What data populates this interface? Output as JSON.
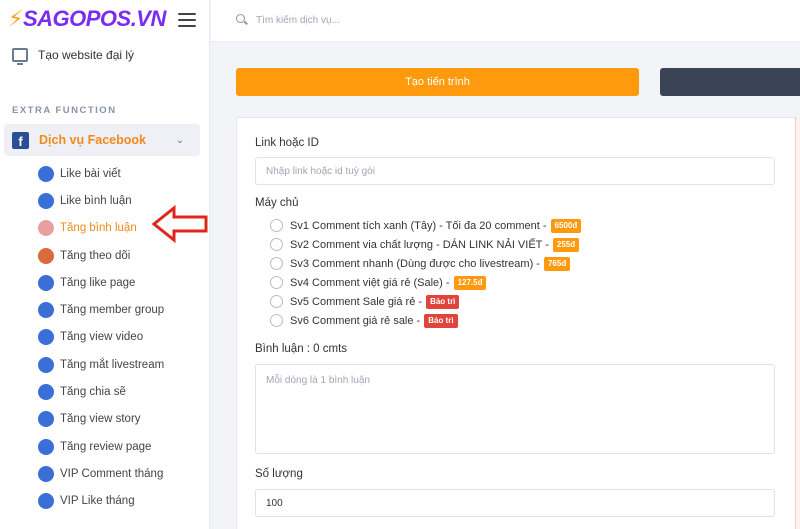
{
  "brand": {
    "logo_text": "SAGOPOS.VN"
  },
  "sidebar": {
    "agency_label": "Tạo website đại lý",
    "section_title": "EXTRA FUNCTION",
    "group_label": "Dịch vụ Facebook",
    "items": [
      {
        "label": "Like bài viết",
        "icon": "thumbs-up-icon",
        "color": "#3b6fd8"
      },
      {
        "label": "Like bình luận",
        "icon": "like-comment-icon",
        "color": "#3b6fd8"
      },
      {
        "label": "Tăng bình luận",
        "icon": "comment-icon",
        "color": "#e7a0a0",
        "active": true
      },
      {
        "label": "Tăng theo dõi",
        "icon": "follow-icon",
        "color": "#d86b3b"
      },
      {
        "label": "Tăng like page",
        "icon": "flag-icon",
        "color": "#3b6fd8"
      },
      {
        "label": "Tăng member group",
        "icon": "group-icon",
        "color": "#3b6fd8"
      },
      {
        "label": "Tăng view video",
        "icon": "play-icon",
        "color": "#3b6fd8"
      },
      {
        "label": "Tăng mắt livestream",
        "icon": "live-icon",
        "color": "#3b6fd8"
      },
      {
        "label": "Tăng chia sẽ",
        "icon": "share-icon",
        "color": "#3b6fd8"
      },
      {
        "label": "Tăng view story",
        "icon": "heart-icon",
        "color": "#3b6fd8"
      },
      {
        "label": "Tăng review page",
        "icon": "star-icon",
        "color": "#3b6fd8"
      },
      {
        "label": "VIP Comment tháng",
        "icon": "vip-comment-icon",
        "color": "#3b6fd8"
      },
      {
        "label": "VIP Like tháng",
        "icon": "clock-icon",
        "color": "#3b6fd8"
      }
    ]
  },
  "search": {
    "placeholder": "Tìm kiếm dịch vụ..."
  },
  "actions": {
    "create_label": "Tạo tiến trình"
  },
  "form": {
    "link_label": "Link hoặc ID",
    "link_placeholder": "Nhập link hoặc id tuỳ gói",
    "server_label": "Máy chủ",
    "servers": [
      {
        "text": "Sv1 Comment tích xanh (Tây) - Tối đa 20 comment -",
        "badge": "6500đ",
        "badge_type": "price"
      },
      {
        "text": "Sv2 Comment via chất lượng - DÁN LINK NẢI VIẾT -",
        "badge": "255đ",
        "badge_type": "price"
      },
      {
        "text": "Sv3 Comment nhanh (Dùng được cho livestream) -",
        "badge": "765đ",
        "badge_type": "price"
      },
      {
        "text": "Sv4 Comment việt giá rẻ (Sale) -",
        "badge": "127.5đ",
        "badge_type": "price"
      },
      {
        "text": "Sv5 Comment Sale giá rẻ -",
        "badge": "Bảo trì",
        "badge_type": "maint"
      },
      {
        "text": "Sv6 Comment giá rẻ sale -",
        "badge": "Bảo trì",
        "badge_type": "maint"
      }
    ],
    "comment_label": "Bình luận : 0 cmts",
    "comment_placeholder": "Mỗi dòng là 1 bình luận",
    "quantity_label": "Số lượng",
    "quantity_value": "100"
  },
  "colors": {
    "accent": "#ff9a0f",
    "brand": "#7b2cf0",
    "dark_button": "#3a4456",
    "maintenance": "#e0443a"
  }
}
